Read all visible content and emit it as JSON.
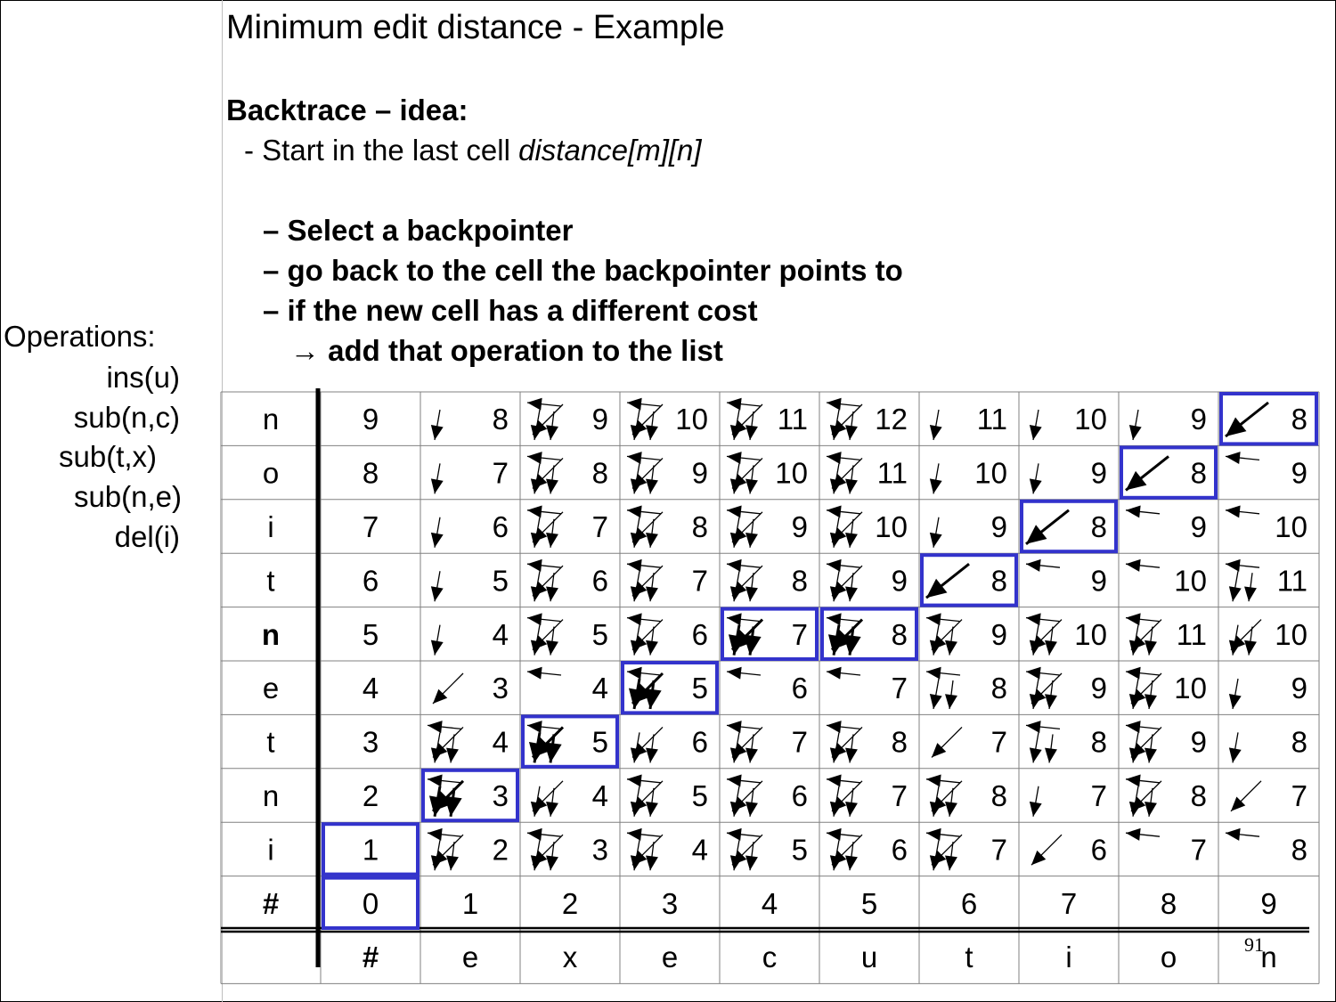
{
  "slide": {
    "title": "Minimum edit distance - Example",
    "heading": "Backtrace – idea:",
    "intro_prefix": "- Start in the last cell ",
    "intro_emph": "distance[m][n]",
    "steps": [
      "– Select a backpointer",
      "– go back to the cell the backpointer points to",
      "– if the new cell has a different cost",
      "→ add that operation to the list"
    ],
    "page_number": "91"
  },
  "operations": {
    "label": "Operations:",
    "items": [
      "ins(u)",
      "sub(n,c)",
      "sub(t,x)",
      "sub(n,e)",
      "del(i)"
    ]
  },
  "table": {
    "target_word": [
      "#",
      "e",
      "x",
      "e",
      "c",
      "u",
      "t",
      "i",
      "o",
      "n"
    ],
    "source_rows": [
      {
        "label": "n",
        "bold": false,
        "values": [
          9,
          8,
          9,
          10,
          11,
          12,
          11,
          10,
          9,
          8
        ],
        "arrows": [
          "",
          "d",
          "lhd",
          "lhd",
          "lhd",
          "lhd",
          "d",
          "d",
          "d",
          "H"
        ]
      },
      {
        "label": "o",
        "bold": false,
        "values": [
          8,
          7,
          8,
          9,
          10,
          11,
          10,
          9,
          8,
          9
        ],
        "arrows": [
          "",
          "d",
          "lhd",
          "lhd",
          "lhd",
          "lhd",
          "d",
          "d",
          "H",
          "l"
        ]
      },
      {
        "label": "i",
        "bold": false,
        "values": [
          7,
          6,
          7,
          8,
          9,
          10,
          9,
          8,
          9,
          10
        ],
        "arrows": [
          "",
          "d",
          "lhd",
          "lhd",
          "lhd",
          "lhd",
          "d",
          "H",
          "l",
          "l"
        ]
      },
      {
        "label": "t",
        "bold": false,
        "values": [
          6,
          5,
          6,
          7,
          8,
          9,
          8,
          9,
          10,
          11
        ],
        "arrows": [
          "",
          "d",
          "lhd",
          "lhd",
          "lhd",
          "lhd",
          "H",
          "l",
          "l",
          "ld"
        ]
      },
      {
        "label": "n",
        "bold": true,
        "values": [
          5,
          4,
          5,
          6,
          7,
          8,
          9,
          10,
          11,
          10
        ],
        "arrows": [
          "",
          "d",
          "lhd",
          "lhd",
          "lhdB",
          "lhdB",
          "lhd",
          "lhd",
          "lhd",
          "hd"
        ]
      },
      {
        "label": "e",
        "bold": false,
        "values": [
          4,
          3,
          4,
          5,
          6,
          7,
          8,
          9,
          10,
          9
        ],
        "arrows": [
          "",
          "h",
          "l",
          "lhdB",
          "l",
          "l",
          "ld",
          "lhd",
          "lhd",
          "d"
        ]
      },
      {
        "label": "t",
        "bold": false,
        "values": [
          3,
          4,
          5,
          6,
          7,
          8,
          7,
          8,
          9,
          8
        ],
        "arrows": [
          "",
          "lhd",
          "lhdB",
          "hd",
          "lhd",
          "lhd",
          "h",
          "ld",
          "lhd",
          "d"
        ]
      },
      {
        "label": "n",
        "bold": false,
        "values": [
          2,
          3,
          4,
          5,
          6,
          7,
          8,
          7,
          8,
          7
        ],
        "arrows": [
          "",
          "lhdB",
          "hd",
          "lhd",
          "lhd",
          "lhd",
          "lhd",
          "d",
          "lhd",
          "h"
        ]
      },
      {
        "label": "i",
        "bold": false,
        "values": [
          1,
          2,
          3,
          4,
          5,
          6,
          7,
          6,
          7,
          8
        ],
        "arrows": [
          "",
          "lhd",
          "lhd",
          "lhd",
          "lhd",
          "lhd",
          "lhd",
          "h",
          "l",
          "l"
        ]
      }
    ],
    "base_row": {
      "label": "#",
      "values": [
        0,
        1,
        2,
        3,
        4,
        5,
        6,
        7,
        8,
        9
      ]
    },
    "highlighted_cells": [
      [
        0,
        9
      ],
      [
        1,
        8
      ],
      [
        2,
        7
      ],
      [
        3,
        6
      ],
      [
        4,
        5
      ],
      [
        4,
        4
      ],
      [
        5,
        3
      ],
      [
        6,
        2
      ],
      [
        7,
        1
      ],
      [
        8,
        0
      ],
      [
        9,
        0
      ]
    ],
    "colors": {
      "highlight": "#3333cc",
      "grid": "#808080",
      "text": "#000000"
    }
  }
}
